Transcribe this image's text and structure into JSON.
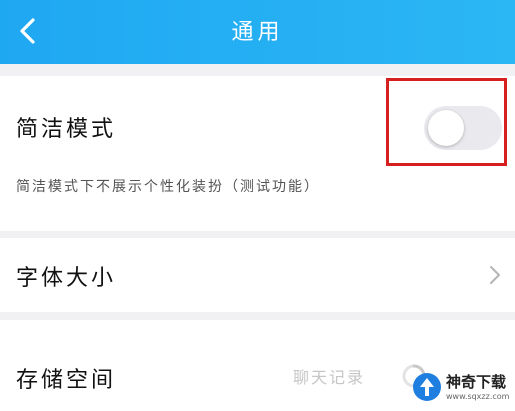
{
  "header": {
    "title": "通用",
    "back_icon": "chevron-left-icon",
    "background": "#1fa8f2"
  },
  "simple_mode": {
    "label": "简洁模式",
    "description": "简洁模式下不展示个性化装扮（测试功能）",
    "toggle_on": false,
    "highlight_color": "#d6201f"
  },
  "font_size": {
    "label": "字体大小",
    "icon": "chevron-right-icon"
  },
  "storage": {
    "label": "存储空间",
    "subtitle": "聊天记录",
    "icon": "loading-spinner-icon"
  },
  "watermark": {
    "name": "神奇下载",
    "url": "www.sqxzz.com"
  }
}
